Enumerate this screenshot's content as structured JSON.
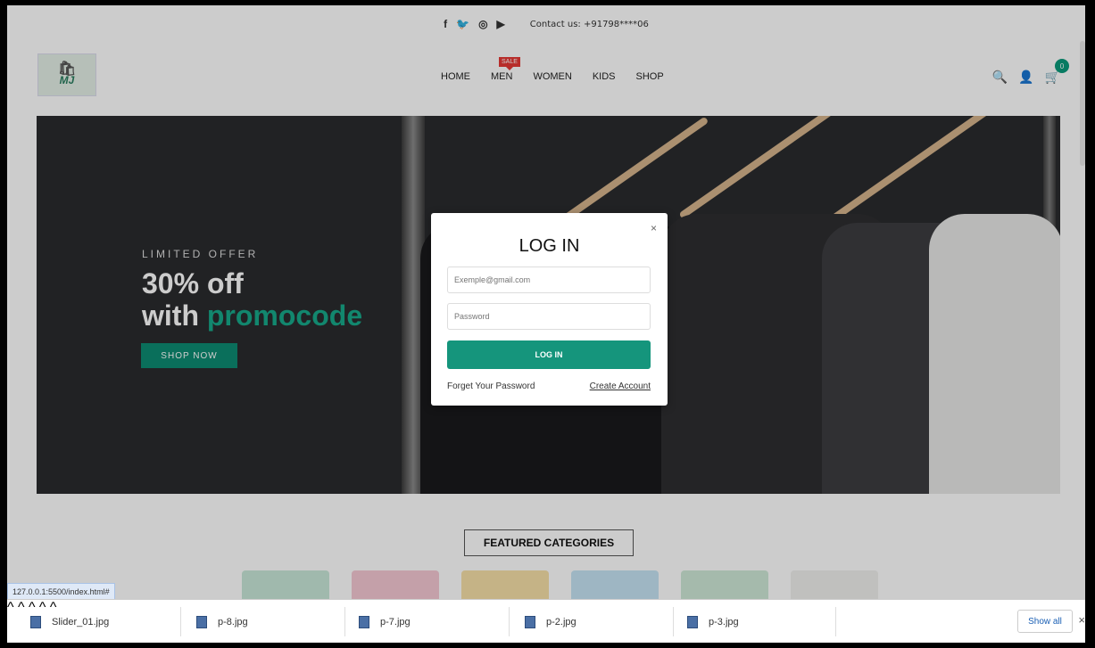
{
  "topbar": {
    "social_icons": [
      "facebook-icon",
      "twitter-icon",
      "instagram-icon",
      "youtube-icon"
    ],
    "social_glyphs": [
      "f",
      "🐦",
      "◎",
      "▶"
    ],
    "contact": "Contact us: +91798****06"
  },
  "header": {
    "logo_text": "MJ",
    "nav": [
      {
        "label": "HOME"
      },
      {
        "label": "MEN",
        "badge": "SALE"
      },
      {
        "label": "WOMEN"
      },
      {
        "label": "KIDS"
      },
      {
        "label": "SHOP"
      }
    ],
    "cart_count": "0"
  },
  "hero": {
    "small": "LIMITED OFFER",
    "line1": "30% off",
    "line2a": "with ",
    "line2b": "promocode",
    "button": "SHOP NOW"
  },
  "featured": {
    "title": "FEATURED CATEGORIES"
  },
  "modal": {
    "title": "LOG IN",
    "close": "×",
    "email_placeholder": "Exemple@gmail.com",
    "password_placeholder": "Password",
    "login_button": "LOG IN",
    "forgot": "Forget Your Password",
    "create": "Create Account"
  },
  "status_url": "127.0.0.1:5500/index.html#",
  "downloads": {
    "items": [
      "Slider_01.jpg",
      "p-8.jpg",
      "p-7.jpg",
      "p-2.jpg",
      "p-3.jpg"
    ],
    "show_all": "Show all",
    "close": "×"
  }
}
